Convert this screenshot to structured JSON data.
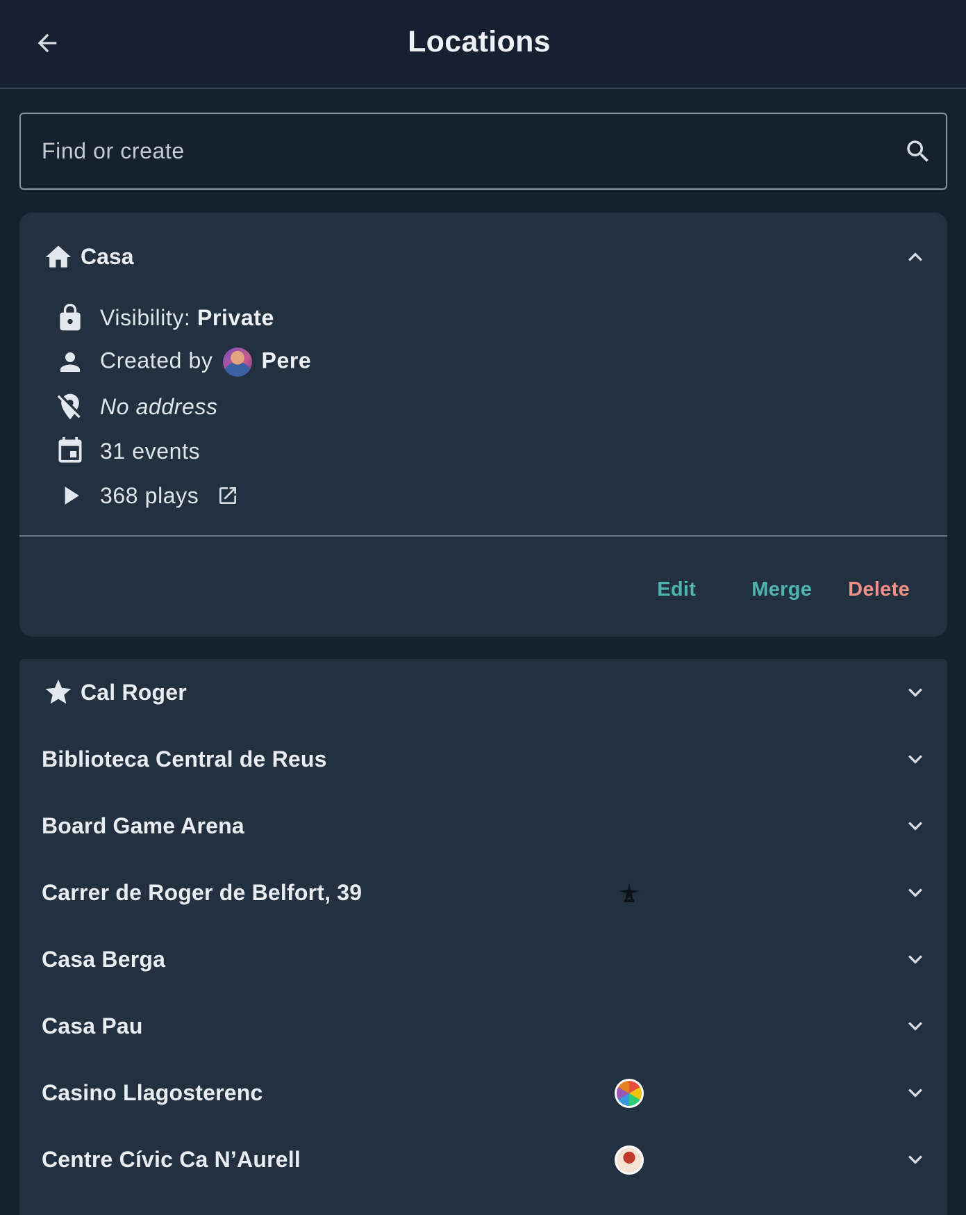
{
  "header": {
    "title": "Locations"
  },
  "search": {
    "placeholder": "Find or create"
  },
  "expanded": {
    "title": "Casa",
    "visibility_label": "Visibility: ",
    "visibility_value": "Private",
    "created_by_label": "Created by",
    "creator": "Pere",
    "address": "No address",
    "events": "31 events",
    "plays": "368 plays",
    "actions": {
      "edit": "Edit",
      "merge": "Merge",
      "delete": "Delete"
    }
  },
  "locations": [
    {
      "name": "Cal Roger",
      "icon": "star-icon"
    },
    {
      "name": "Biblioteca Central de Reus"
    },
    {
      "name": "Board Game Arena"
    },
    {
      "name": "Carrer de Roger de Belfort, 39",
      "badge": "emblem-badge"
    },
    {
      "name": "Casa Berga"
    },
    {
      "name": "Casa Pau"
    },
    {
      "name": "Casino Llagosterenc",
      "badge": "colorful-logo-badge"
    },
    {
      "name": "Centre Cívic Ca N’Aurell",
      "badge": "avatar-badge"
    }
  ],
  "colors": {
    "background": "#162130",
    "card": "#22303f",
    "accent": "#4fb3b0",
    "danger": "#f08f86"
  }
}
